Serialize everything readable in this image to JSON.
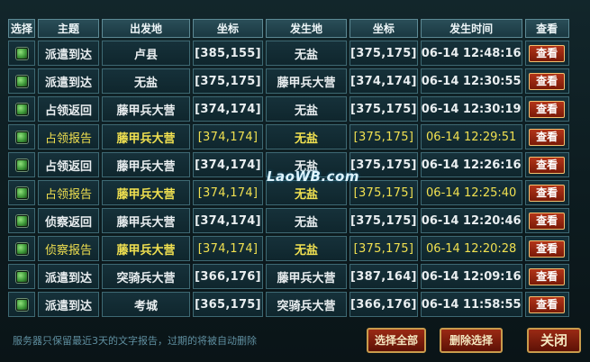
{
  "headers": [
    "选择",
    "主题",
    "出发地",
    "坐标",
    "发生地",
    "坐标",
    "发生时间",
    "查看"
  ],
  "view_label": "查看",
  "rows": [
    {
      "subject": "派遣到达",
      "origin": "卢县",
      "origin_coord": "[385,155]",
      "target": "无盐",
      "target_coord": "[375,175]",
      "time": "06-14 12:48:16",
      "highlight": false
    },
    {
      "subject": "派遣到达",
      "origin": "无盐",
      "origin_coord": "[375,175]",
      "target": "藤甲兵大营",
      "target_coord": "[374,174]",
      "time": "06-14 12:30:55",
      "highlight": false
    },
    {
      "subject": "占领返回",
      "origin": "藤甲兵大营",
      "origin_coord": "[374,174]",
      "target": "无盐",
      "target_coord": "[375,175]",
      "time": "06-14 12:30:19",
      "highlight": false
    },
    {
      "subject": "占领报告",
      "origin": "藤甲兵大营",
      "origin_coord": "[374,174]",
      "target": "无盐",
      "target_coord": "[375,175]",
      "time": "06-14 12:29:51",
      "highlight": true
    },
    {
      "subject": "占领返回",
      "origin": "藤甲兵大营",
      "origin_coord": "[374,174]",
      "target": "无盐",
      "target_coord": "[375,175]",
      "time": "06-14 12:26:16",
      "highlight": false
    },
    {
      "subject": "占领报告",
      "origin": "藤甲兵大营",
      "origin_coord": "[374,174]",
      "target": "无盐",
      "target_coord": "[375,175]",
      "time": "06-14 12:25:40",
      "highlight": true
    },
    {
      "subject": "侦察返回",
      "origin": "藤甲兵大营",
      "origin_coord": "[374,174]",
      "target": "无盐",
      "target_coord": "[375,175]",
      "time": "06-14 12:20:46",
      "highlight": false
    },
    {
      "subject": "侦察报告",
      "origin": "藤甲兵大营",
      "origin_coord": "[374,174]",
      "target": "无盐",
      "target_coord": "[375,175]",
      "time": "06-14 12:20:28",
      "highlight": true
    },
    {
      "subject": "派遣到达",
      "origin": "突骑兵大营",
      "origin_coord": "[366,176]",
      "target": "藤甲兵大营",
      "target_coord": "[387,164]",
      "time": "06-14 12:09:16",
      "highlight": false
    },
    {
      "subject": "派遣到达",
      "origin": "考城",
      "origin_coord": "[365,175]",
      "target": "突骑兵大营",
      "target_coord": "[366,176]",
      "time": "06-14 11:58:55",
      "highlight": false
    }
  ],
  "footer": {
    "note": "服务器只保留最近3天的文字报告，过期的将被自动删除",
    "select_all": "选择全部",
    "delete_selected": "删除选择",
    "close": "关闭"
  },
  "watermark": "LaoWB.com",
  "colors": {
    "highlight_text": "#f0e050",
    "normal_text": "#e9eef0",
    "button_red": "#9a2a14",
    "button_border": "#c99b4c"
  }
}
